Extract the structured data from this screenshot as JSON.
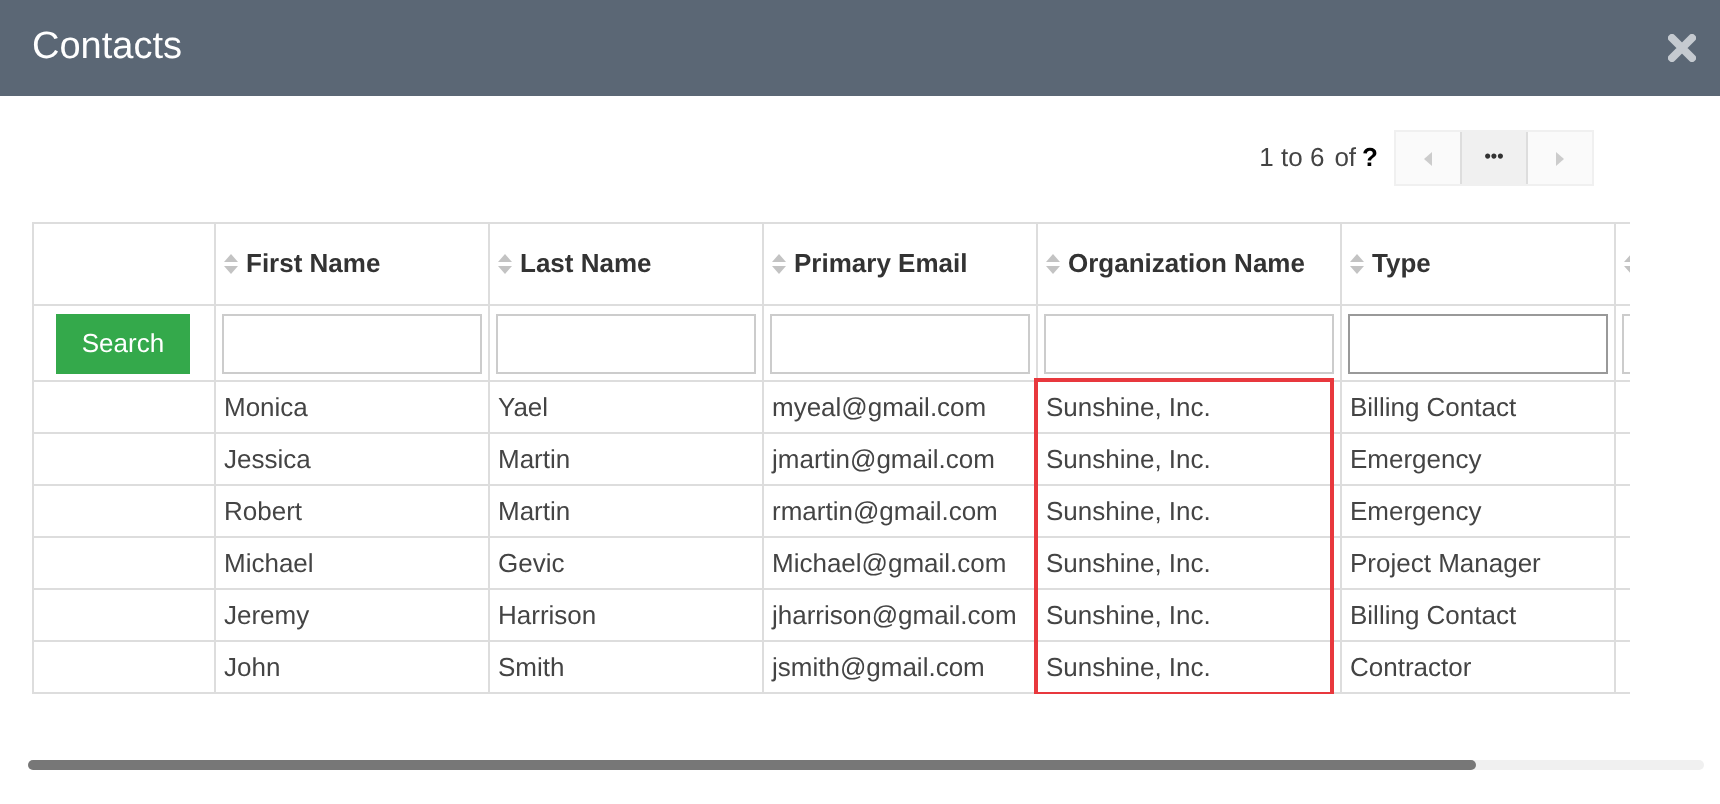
{
  "window": {
    "title": "Contacts"
  },
  "pager": {
    "range": "1 to 6",
    "of": "of",
    "total": "?",
    "more": "•••"
  },
  "search_button": "Search",
  "columns": [
    {
      "label": "First Name",
      "highlighted": false
    },
    {
      "label": "Last Name",
      "highlighted": false
    },
    {
      "label": "Primary Email",
      "highlighted": false
    },
    {
      "label": "Organization Name",
      "highlighted": true
    },
    {
      "label": "Type",
      "highlighted": false
    }
  ],
  "rows": [
    {
      "cells": [
        "Monica",
        "Yael",
        "myeal@gmail.com",
        "Sunshine, Inc.",
        "Billing Contact"
      ]
    },
    {
      "cells": [
        "Jessica",
        "Martin",
        "jmartin@gmail.com",
        "Sunshine, Inc.",
        "Emergency"
      ]
    },
    {
      "cells": [
        "Robert",
        "Martin",
        "rmartin@gmail.com",
        "Sunshine, Inc.",
        "Emergency"
      ]
    },
    {
      "cells": [
        "Michael",
        "Gevic",
        "Michael@gmail.com",
        "Sunshine, Inc.",
        "Project Manager"
      ]
    },
    {
      "cells": [
        "Jeremy",
        "Harrison",
        "jharrison@gmail.com",
        "Sunshine, Inc.",
        "Billing Contact"
      ]
    },
    {
      "cells": [
        "John",
        "Smith",
        "jsmith@gmail.com",
        "Sunshine, Inc.",
        "Contractor"
      ]
    }
  ]
}
